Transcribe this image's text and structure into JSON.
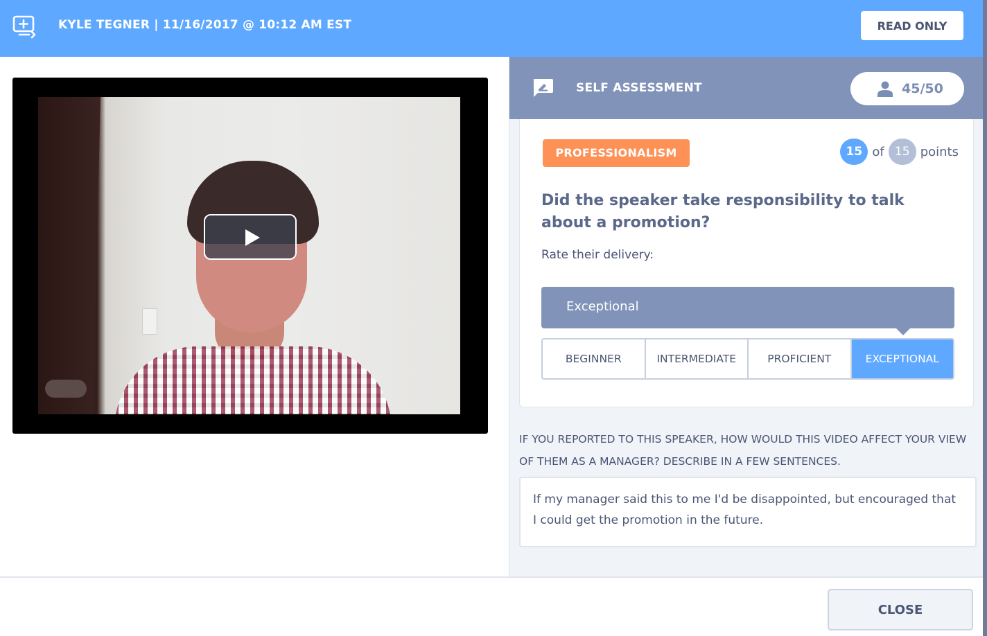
{
  "header": {
    "icon": "screen-share-icon",
    "title": "KYLE TEGNER | 11/16/2017 @ 10:12 AM EST",
    "read_only_label": "READ ONLY",
    "background_color": "#5ea8ff"
  },
  "video": {
    "play_icon": "play-icon"
  },
  "assessment": {
    "icon": "edit-comment-icon",
    "title": "SELF ASSESSMENT",
    "score_icon": "person-icon",
    "score": "45/50",
    "header_color": "#8193b9"
  },
  "question": {
    "category": "PROFESSIONALISM",
    "category_color": "#fe9156",
    "points_earned": "15",
    "points_of": "of",
    "points_total": "15",
    "points_label": "points",
    "text": "Did the speaker take responsibility to talk about a promotion?",
    "rate_label": "Rate their delivery:",
    "selected_rating": "Exceptional",
    "rating_options": [
      {
        "label": "BEGINNER",
        "selected": false
      },
      {
        "label": "INTERMEDIATE",
        "selected": false
      },
      {
        "label": "PROFICIENT",
        "selected": false
      },
      {
        "label": "EXCEPTIONAL",
        "selected": true
      }
    ],
    "accent_color": "#5ea8ff"
  },
  "comment": {
    "prompt": "IF YOU REPORTED TO THIS SPEAKER, HOW WOULD THIS VIDEO AFFECT YOUR VIEW OF THEM AS A MANAGER? DESCRIBE IN A FEW SENTENCES.",
    "response": "If my manager said this to me I'd be disappointed, but encouraged that I could get the promotion in the future."
  },
  "footer": {
    "close_label": "CLOSE"
  }
}
